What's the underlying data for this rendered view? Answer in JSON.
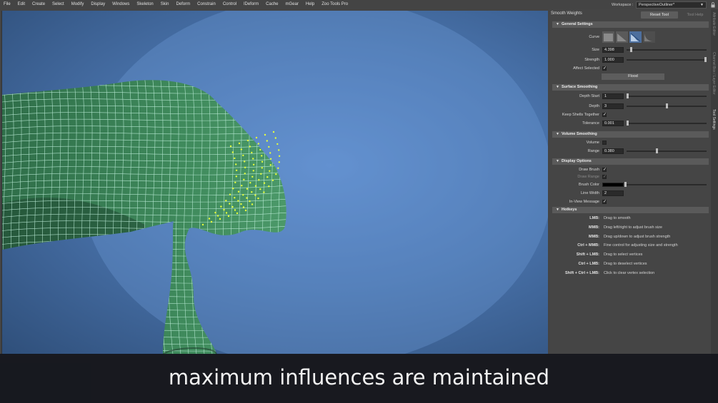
{
  "menubar": {
    "items": [
      "File",
      "Edit",
      "Create",
      "Select",
      "Modify",
      "Display",
      "Windows",
      "Skeleton",
      "Skin",
      "Deform",
      "Constrain",
      "Control",
      "lDeform",
      "Cache",
      "mGear",
      "Help",
      "Zoo Tools Pro"
    ],
    "workspace_label": "Workspace :",
    "workspace_value": "PerspectiveOutliner*"
  },
  "panel": {
    "title": "Smooth Weights",
    "reset_tool": "Reset Tool",
    "tool_help": "Tool Help",
    "general": {
      "header": "General Settings",
      "curve_label": "Curve",
      "size_label": "Size",
      "size_value": "4.398",
      "size_fraction": 0.05,
      "strength_label": "Strength",
      "strength_value": "1.000",
      "strength_fraction": 1.0,
      "affect_selected_label": "Affect Selected",
      "affect_selected": "✓",
      "flood_label": "Flood"
    },
    "surface": {
      "header": "Surface Smoothing",
      "depth_start_label": "Depth Start",
      "depth_start_value": "1",
      "depth_start_fraction": 0.0,
      "depth_label": "Depth",
      "depth_value": "3",
      "depth_fraction": 0.5,
      "keep_shells_label": "Keep Shells Together",
      "keep_shells": "✓",
      "tolerance_label": "Tolerance",
      "tolerance_value": "0.001",
      "tolerance_fraction": 0.0
    },
    "volume": {
      "header": "Volume Smoothing",
      "volume_label": "Volume",
      "volume_check": "",
      "range_label": "Range",
      "range_value": "0.380",
      "range_fraction": 0.38
    },
    "display": {
      "header": "Display Options",
      "draw_brush_label": "Draw Brush",
      "draw_brush": "✓",
      "draw_range_label": "Draw Range",
      "draw_range": "✓",
      "brush_color_label": "Brush Color",
      "brush_color": "#000000",
      "line_width_label": "Line Width",
      "line_width_value": "2",
      "in_view_label": "In-View Message",
      "in_view": "✓"
    },
    "hotkeys": {
      "header": "Hotkeys",
      "rows": [
        {
          "key": "LMB:",
          "desc": "Drag to smooth"
        },
        {
          "key": "MMB:",
          "desc": "Drag left/right to adjust brush size"
        },
        {
          "key": "MMB:",
          "desc": "Drag up/down to adjust brush strength"
        },
        {
          "key": "Ctrl + MMB:",
          "desc": "Fine control for adjusting size and strength"
        },
        {
          "key": "Shift + LMB:",
          "desc": "Drag to select vertices"
        },
        {
          "key": "Ctrl + LMB:",
          "desc": "Drag to deselect vertices"
        },
        {
          "key": "Shift + Ctrl + LMB:",
          "desc": "Click to clear vertex selection"
        }
      ]
    }
  },
  "side_tabs": [
    "Attribute Editor",
    "Channel Box / Layer Editor",
    "Tool Settings"
  ],
  "caption": "maximum influences are maintained",
  "colors": {
    "mesh_fill": "#3f8a5c",
    "wire": "#bff5df",
    "selected_vertex": "#e6ff3c",
    "accent": "#4d6f9e"
  }
}
